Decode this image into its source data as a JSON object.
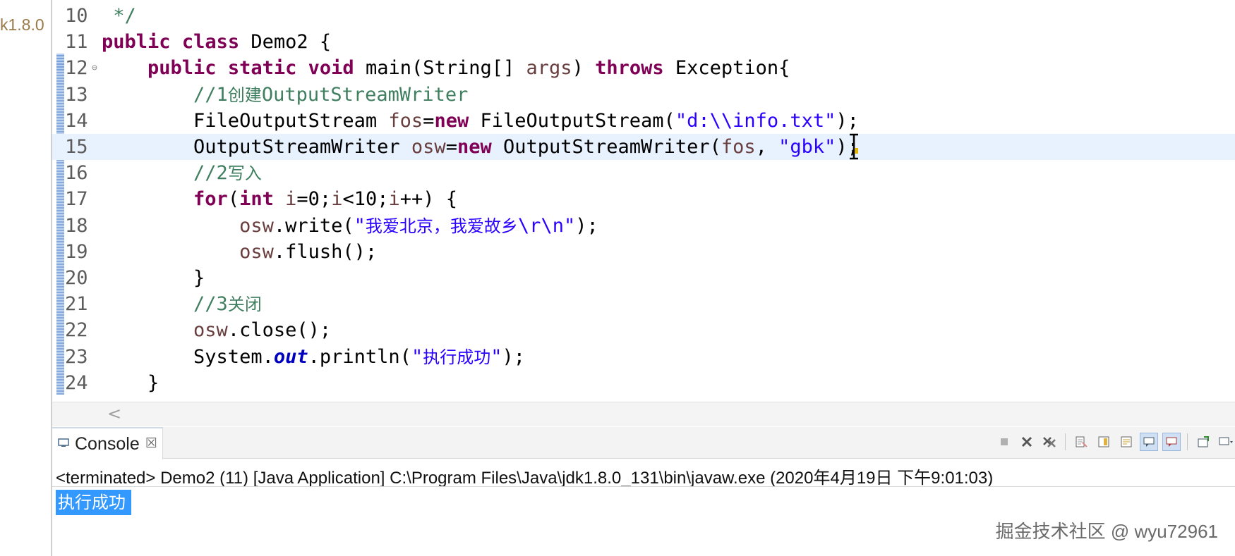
{
  "left_panel": {
    "truncated_text": "k1.8.0"
  },
  "editor": {
    "lines": [
      {
        "n": "10",
        "segments": [
          {
            "t": " */",
            "c": "cmt"
          }
        ]
      },
      {
        "n": "11",
        "segments": [
          {
            "t": "public",
            "c": "kw"
          },
          {
            "t": " "
          },
          {
            "t": "class",
            "c": "kw"
          },
          {
            "t": " Demo2 {"
          }
        ]
      },
      {
        "n": "12",
        "fold": "⊖",
        "segments": [
          {
            "t": "    "
          },
          {
            "t": "public",
            "c": "kw"
          },
          {
            "t": " "
          },
          {
            "t": "static",
            "c": "kw"
          },
          {
            "t": " "
          },
          {
            "t": "void",
            "c": "kw"
          },
          {
            "t": " main(String[] "
          },
          {
            "t": "args",
            "c": "var"
          },
          {
            "t": ") "
          },
          {
            "t": "throws",
            "c": "kw"
          },
          {
            "t": " Exception{"
          }
        ]
      },
      {
        "n": "13",
        "segments": [
          {
            "t": "        "
          },
          {
            "t": "//1",
            "c": "cmt"
          },
          {
            "t": "创建",
            "c": "cmt-zh"
          },
          {
            "t": "OutputStreamWriter",
            "c": "cmt"
          }
        ]
      },
      {
        "n": "14",
        "segments": [
          {
            "t": "        FileOutputStream "
          },
          {
            "t": "fos",
            "c": "var"
          },
          {
            "t": "="
          },
          {
            "t": "new",
            "c": "kw"
          },
          {
            "t": " FileOutputStream("
          },
          {
            "t": "\"d:\\\\info.txt\"",
            "c": "str"
          },
          {
            "t": ");"
          }
        ]
      },
      {
        "n": "15",
        "current": true,
        "segments": [
          {
            "t": "        OutputStreamWriter "
          },
          {
            "t": "osw",
            "c": "var"
          },
          {
            "t": "="
          },
          {
            "t": "new",
            "c": "kw"
          },
          {
            "t": " OutputStreamWriter("
          },
          {
            "t": "fos",
            "c": "var"
          },
          {
            "t": ", "
          },
          {
            "t": "\"gbk\"",
            "c": "str"
          },
          {
            "t": ");"
          }
        ]
      },
      {
        "n": "16",
        "segments": [
          {
            "t": "        "
          },
          {
            "t": "//2",
            "c": "cmt"
          },
          {
            "t": "写入",
            "c": "cmt-zh"
          }
        ]
      },
      {
        "n": "17",
        "segments": [
          {
            "t": "        "
          },
          {
            "t": "for",
            "c": "kw"
          },
          {
            "t": "("
          },
          {
            "t": "int",
            "c": "kw"
          },
          {
            "t": " "
          },
          {
            "t": "i",
            "c": "var"
          },
          {
            "t": "=0;"
          },
          {
            "t": "i",
            "c": "var"
          },
          {
            "t": "<10;"
          },
          {
            "t": "i",
            "c": "var"
          },
          {
            "t": "++) {"
          }
        ]
      },
      {
        "n": "18",
        "segments": [
          {
            "t": "            "
          },
          {
            "t": "osw",
            "c": "var"
          },
          {
            "t": ".write("
          },
          {
            "t": "\"",
            "c": "str"
          },
          {
            "t": "我爱北京，我爱故乡",
            "c": "str-zh"
          },
          {
            "t": "\\r\\n\"",
            "c": "str"
          },
          {
            "t": ");"
          }
        ]
      },
      {
        "n": "19",
        "segments": [
          {
            "t": "            "
          },
          {
            "t": "osw",
            "c": "var"
          },
          {
            "t": ".flush();"
          }
        ]
      },
      {
        "n": "20",
        "segments": [
          {
            "t": "        }"
          }
        ]
      },
      {
        "n": "21",
        "segments": [
          {
            "t": "        "
          },
          {
            "t": "//3",
            "c": "cmt"
          },
          {
            "t": "关闭",
            "c": "cmt-zh"
          }
        ]
      },
      {
        "n": "22",
        "segments": [
          {
            "t": "        "
          },
          {
            "t": "osw",
            "c": "var"
          },
          {
            "t": ".close();"
          }
        ]
      },
      {
        "n": "23",
        "segments": [
          {
            "t": "        System."
          },
          {
            "t": "out",
            "c": "field"
          },
          {
            "t": ".println("
          },
          {
            "t": "\"",
            "c": "str"
          },
          {
            "t": "执行成功",
            "c": "str-zh"
          },
          {
            "t": "\"",
            "c": "str"
          },
          {
            "t": ");"
          }
        ]
      },
      {
        "n": "24",
        "segments": [
          {
            "t": "    }"
          }
        ]
      }
    ]
  },
  "scrollbar": {
    "left_arrow": "<"
  },
  "console": {
    "tab_label": "Console",
    "close_glyph": "☒",
    "status": "<terminated> Demo2 (11) [Java Application] C:\\Program Files\\Java\\jdk1.8.0_131\\bin\\javaw.exe (2020年4月19日 下午9:01:03)",
    "output": "执行成功",
    "toolbar_icons": [
      "terminate-icon",
      "remove-launch-icon",
      "remove-all-terminated-icon",
      "clear-console-icon",
      "scroll-lock-icon",
      "word-wrap-icon",
      "show-on-stdout-icon",
      "show-on-stderr-icon",
      "pin-console-icon",
      "display-selected-console-icon"
    ]
  },
  "watermark": "掘金技术社区 @ wyu72961"
}
